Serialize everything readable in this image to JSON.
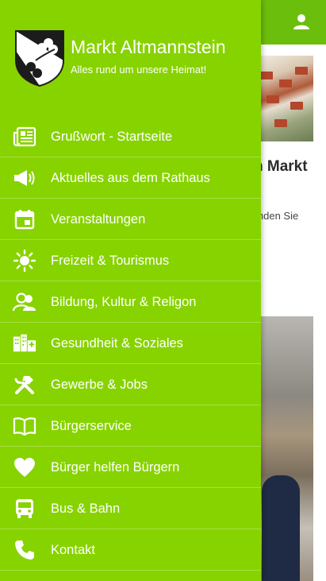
{
  "app": {
    "title": "Markt Altmannstein",
    "tagline": "Alles rund um unsere Heimat!",
    "accent_color": "#87d300",
    "appbar_color": "#6cbe0c"
  },
  "background_page": {
    "heading_fragment": "n Markt",
    "text_fragment": "inden Sie",
    "appbar_icon": "user-icon"
  },
  "menu": {
    "items": [
      {
        "label": "Grußwort - Startseite",
        "icon": "newspaper-icon"
      },
      {
        "label": "Aktuelles aus dem Rathaus",
        "icon": "megaphone-icon"
      },
      {
        "label": "Veranstaltungen",
        "icon": "calendar-icon"
      },
      {
        "label": "Freizeit & Tourismus",
        "icon": "sun-icon"
      },
      {
        "label": "Bildung, Kultur & Religon",
        "icon": "people-icon"
      },
      {
        "label": "Gesundheit & Soziales",
        "icon": "city-icon"
      },
      {
        "label": "Gewerbe & Jobs",
        "icon": "tools-icon"
      },
      {
        "label": "Bürgerservice",
        "icon": "book-icon"
      },
      {
        "label": "Bürger helfen Bürgern",
        "icon": "heart-icon"
      },
      {
        "label": "Bus & Bahn",
        "icon": "bus-icon"
      },
      {
        "label": "Kontakt",
        "icon": "phone-icon"
      }
    ]
  }
}
